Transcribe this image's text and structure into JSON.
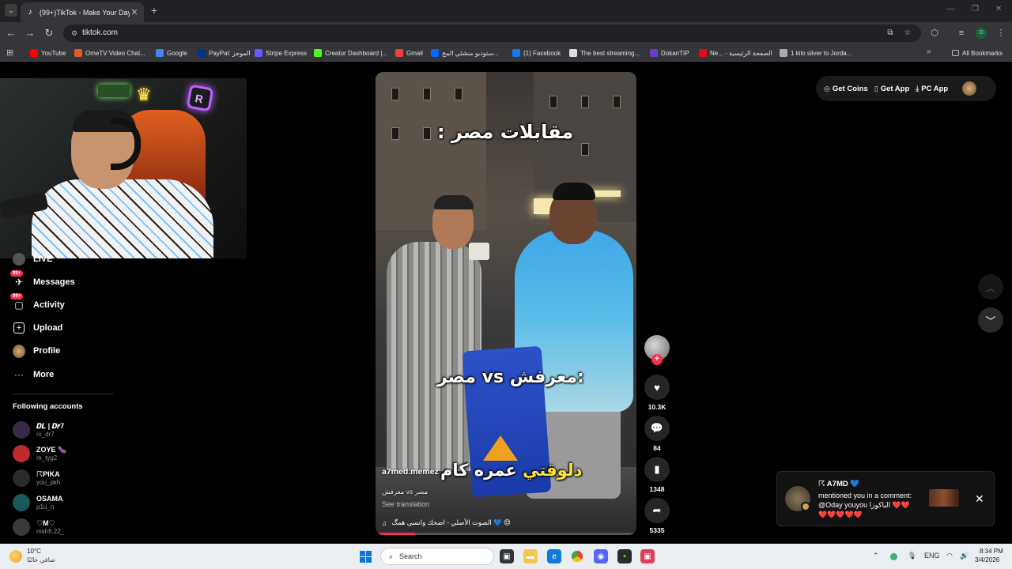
{
  "browser": {
    "tab_title": "(99+)TikTok - Make Your Day",
    "url": "tiktok.com",
    "bookmarks": [
      {
        "label": "YouTube",
        "icon": "youtube-icon",
        "color": "#ff0000"
      },
      {
        "label": "OmeTV Video Chat...",
        "icon": "ometv-icon",
        "color": "#e05a2a"
      },
      {
        "label": "Google",
        "icon": "google-icon",
        "color": "#4285f4"
      },
      {
        "label": "PayPal: الموجز",
        "icon": "paypal-icon",
        "color": "#003087"
      },
      {
        "label": "Stripe Express",
        "icon": "stripe-icon",
        "color": "#635bff"
      },
      {
        "label": "Creator Dashboard |...",
        "icon": "kick-icon",
        "color": "#53fc18"
      },
      {
        "label": "Gmail",
        "icon": "gmail-icon",
        "color": "#ea4335"
      },
      {
        "label": "ستوديو منشئي المح...",
        "icon": "meta-icon",
        "color": "#0866ff"
      },
      {
        "label": "(1) Facebook",
        "icon": "facebook-icon",
        "color": "#1877f2"
      },
      {
        "label": "The best streaming...",
        "icon": "streaming-icon",
        "color": "#dddddd"
      },
      {
        "label": "DokanTIP",
        "icon": "dokantip-icon",
        "color": "#6a3cc8"
      },
      {
        "label": "Ne... - الصفحة الرئيسية",
        "icon": "netflix-icon",
        "color": "#e50914"
      },
      {
        "label": "1 kilo silver to Jorda...",
        "icon": "globe-icon",
        "color": "#aaaaaa"
      }
    ],
    "all_bookmarks": "All Bookmarks",
    "profile_initial": "O"
  },
  "sidebar": {
    "items": [
      {
        "label": "LIVE",
        "icon": "live-icon"
      },
      {
        "label": "Messages",
        "icon": "messages-icon",
        "badge": "99+"
      },
      {
        "label": "Activity",
        "icon": "activity-icon",
        "badge": "99+"
      },
      {
        "label": "Upload",
        "icon": "upload-icon"
      },
      {
        "label": "Profile",
        "icon": "profile-avatar-icon"
      },
      {
        "label": "More",
        "icon": "more-icon"
      }
    ],
    "following_title": "Following accounts",
    "accounts": [
      {
        "name": "𝑫𝑳 | 𝑫𝒓7",
        "user": "rx_dr7",
        "color": "#3a2a4a"
      },
      {
        "name": "ZOYE 🍆",
        "user": "m_tyg2",
        "color": "#c02a2a"
      },
      {
        "name": "☈PIKA",
        "user": "you_pkh",
        "color": "#2a2a2a"
      },
      {
        "name": "OSAMA",
        "user": "p1u_n",
        "color": "#1a5a5a"
      },
      {
        "name": "♡M♡",
        "user": "mshfr.22_",
        "color": "#3a3a3a"
      }
    ]
  },
  "video": {
    "top_text": "مقابلات مصر :",
    "mid_text": "مصر vs معرفش:",
    "bottom_text_white": "عمره كام",
    "bottom_text_yellow": "دلوقتي",
    "author": "a7med.memez",
    "caption": "مصر vs معرفش",
    "see_translation": "See translation",
    "music": "الصوت الأصلي - اضحك وانسى همگ 💙 😍",
    "progress": 0.15
  },
  "actions": {
    "likes": "10.3K",
    "comments": "84",
    "saves": "1348",
    "shares": "5335"
  },
  "top_right": {
    "get_coins": "Get Coins",
    "get_app": "Get App",
    "pc_app": "PC App"
  },
  "notification": {
    "name": "☈ A7MD 💙",
    "text": "mentioned you in a comment: @Oday youyou الباكوزا ❤️❤️❤️❤️❤️❤️❤️"
  },
  "taskbar": {
    "temp": "10°C",
    "weather": "صافي غالبًا",
    "search_placeholder": "Search",
    "lang": "ENG",
    "time": "8:34 PM",
    "date": "3/4/2026"
  }
}
